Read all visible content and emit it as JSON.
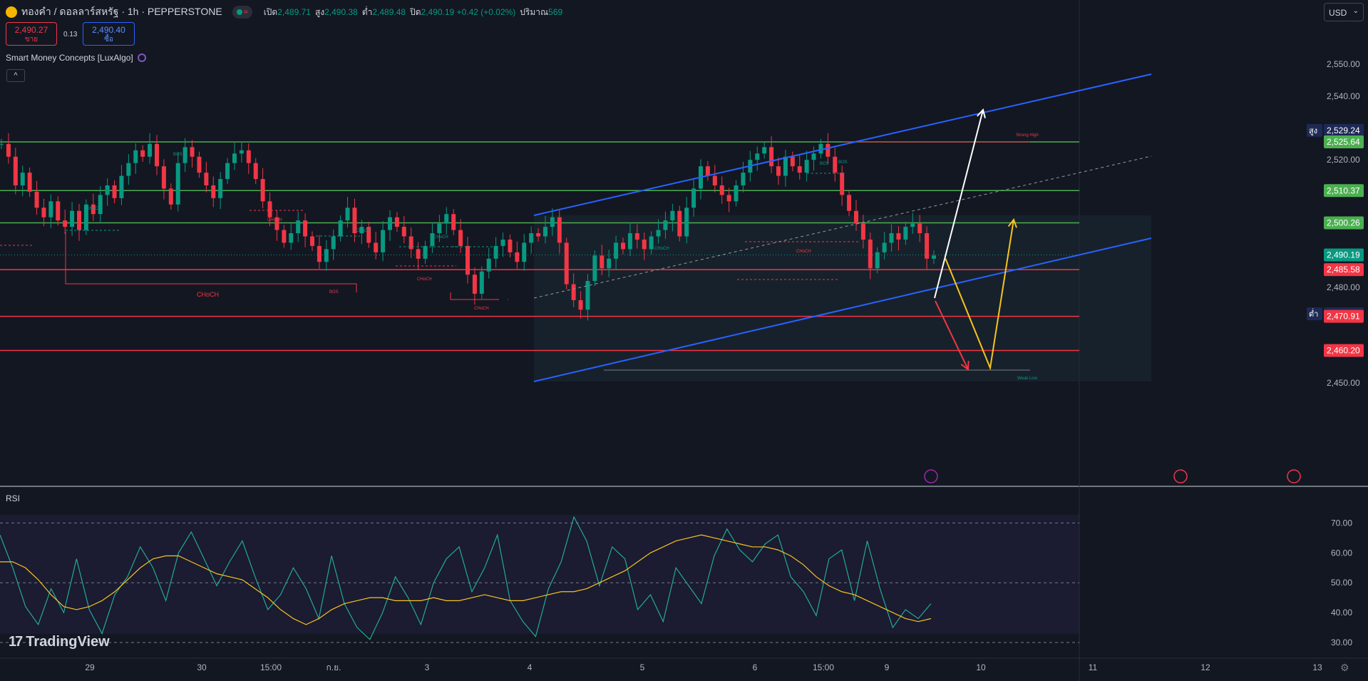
{
  "header": {
    "symbol_title": "ทองคำ / ดอลลาร์สหรัฐ · 1h · PEPPERSTONE",
    "ohlc": [
      {
        "key": "เปิด",
        "value": "2,489.71"
      },
      {
        "key": "สูง",
        "value": "2,490.38"
      },
      {
        "key": "ต่ำ",
        "value": "2,489.48"
      },
      {
        "key": "ปิด",
        "value": "2,490.19 +0.42 (+0.02%)"
      },
      {
        "key": "ปริมาณ",
        "value": "569"
      }
    ]
  },
  "quote": {
    "sell_price": "2,490.27",
    "sell_label": "ขาย",
    "spread": "0.13",
    "buy_price": "2,490.40",
    "buy_label": "ซื้อ"
  },
  "indicator": {
    "name": "Smart Money Concepts [LuxAlgo]",
    "collapse": "^"
  },
  "currency": {
    "label": "USD",
    "chevron": "⌄"
  },
  "price_axis": {
    "ticks": [
      "2,550.00",
      "2,540.00",
      "2,520.00",
      "2,480.00",
      "2,450.00"
    ],
    "tick_values": [
      2550,
      2540,
      2520,
      2480,
      2450
    ],
    "labels": [
      {
        "text": "2,529.24",
        "value": 2529.24,
        "color": "#1e2a55",
        "prefix": "สูง"
      },
      {
        "text": "2,525.64",
        "value": 2525.64,
        "color": "#4caf50"
      },
      {
        "text": "2,510.37",
        "value": 2510.37,
        "color": "#4caf50"
      },
      {
        "text": "2,500.26",
        "value": 2500.26,
        "color": "#4caf50"
      },
      {
        "text": "2,490.19",
        "value": 2490.19,
        "color": "#089981"
      },
      {
        "text": "2,485.58",
        "value": 2485.58,
        "color": "#f23645"
      },
      {
        "text": "2,471.69",
        "value": 2471.69,
        "color": "#1e2a55",
        "prefix": "ต่ำ"
      },
      {
        "text": "2,470.91",
        "value": 2470.91,
        "color": "#f23645"
      },
      {
        "text": "2,460.20",
        "value": 2460.2,
        "color": "#f23645"
      }
    ]
  },
  "levels": {
    "green": [
      2525.64,
      2510.37,
      2500.26
    ],
    "red": [
      2485.58,
      2470.91,
      2460.2
    ],
    "last": 2490.19
  },
  "annotations": {
    "choch_labels": [
      "CHoCH",
      "CHoCH",
      "CHoCH",
      "CHoCH",
      "CHoCH",
      "CHoCH",
      "CHoCH",
      "CHoCH",
      "CHoCH"
    ],
    "bos_labels": [
      "BOS",
      "BOS",
      "BOS",
      "BOS"
    ],
    "strong_high": "Strong High",
    "weak_low": "Weak Low"
  },
  "time_axis": {
    "labels": [
      "29",
      "30",
      "15:00",
      "ก.ย.",
      "3",
      "4",
      "5",
      "6",
      "15:00",
      "9",
      "10",
      "11",
      "12",
      "13"
    ]
  },
  "rsi": {
    "label": "RSI",
    "ticks": [
      "70.00",
      "60.00",
      "50.00",
      "40.00",
      "30.00"
    ],
    "tick_values": [
      70,
      60,
      50,
      40,
      30
    ],
    "rsi_values": [
      66,
      55,
      42,
      36,
      48,
      40,
      58,
      41,
      33,
      46,
      52,
      62,
      55,
      44,
      60,
      67,
      58,
      49,
      57,
      64,
      52,
      41,
      46,
      55,
      48,
      38,
      59,
      43,
      35,
      31,
      40,
      52,
      45,
      36,
      50,
      58,
      62,
      47,
      55,
      66,
      44,
      37,
      32,
      48,
      57,
      72,
      64,
      49,
      62,
      58,
      41,
      46,
      37,
      55,
      49,
      43,
      59,
      68,
      61,
      57,
      63,
      66,
      52,
      47,
      39,
      58,
      61,
      44,
      64,
      48,
      35,
      41,
      38,
      43
    ],
    "ma_values": [
      57,
      57,
      55,
      51,
      46,
      42,
      41,
      42,
      44,
      47,
      51,
      55,
      58,
      59,
      59,
      57,
      55,
      53,
      52,
      51,
      48,
      45,
      41,
      38,
      36,
      38,
      41,
      43,
      44,
      45,
      45,
      44,
      44,
      44,
      45,
      44,
      44,
      45,
      46,
      45,
      44,
      44,
      45,
      46,
      47,
      47,
      48,
      50,
      52,
      54,
      57,
      60,
      62,
      64,
      65,
      66,
      65,
      64,
      63,
      62,
      62,
      61,
      59,
      56,
      52,
      49,
      47,
      46,
      44,
      42,
      40,
      38,
      37,
      38
    ],
    "colors": {
      "rsi": "#22ab94",
      "ma": "#f7c41f"
    }
  },
  "chart_data": {
    "type": "candlestick",
    "title": "ทองคำ / ดอลลาร์สหรัฐ · 1h · PEPPERSTONE",
    "ylim": [
      2441,
      2563
    ],
    "close_path": [
      2525,
      2521,
      2512,
      2516,
      2510,
      2505,
      2502,
      2507,
      2501,
      2499,
      2504,
      2498,
      2506,
      2503,
      2509,
      2512,
      2508,
      2515,
      2519,
      2523,
      2521,
      2525,
      2518,
      2511,
      2506,
      2519,
      2524,
      2521,
      2516,
      2512,
      2508,
      2514,
      2519,
      2522,
      2523,
      2519,
      2514,
      2507,
      2502,
      2498,
      2494,
      2497,
      2501,
      2496,
      2493,
      2488,
      2492,
      2496,
      2501,
      2505,
      2497,
      2499,
      2494,
      2491,
      2498,
      2502,
      2499,
      2496,
      2492,
      2489,
      2493,
      2497,
      2500,
      2503,
      2498,
      2493,
      2484,
      2478,
      2485,
      2489,
      2493,
      2495,
      2491,
      2488,
      2494,
      2497,
      2496,
      2499,
      2502,
      2494,
      2481,
      2476,
      2473,
      2482,
      2490,
      2486,
      2489,
      2494,
      2492,
      2497,
      2495,
      2492,
      2496,
      2498,
      2501,
      2504,
      2496,
      2505,
      2511,
      2518,
      2515,
      2512,
      2509,
      2507,
      2512,
      2516,
      2520,
      2522,
      2524,
      2518,
      2515,
      2521,
      2518,
      2516,
      2520,
      2522,
      2525,
      2521,
      2516,
      2509,
      2504,
      2500,
      2495,
      2486,
      2491,
      2494,
      2497,
      2495,
      2499,
      2500,
      2497,
      2489,
      2490
    ],
    "colors": {
      "up": "#089981",
      "down": "#f23645"
    }
  }
}
